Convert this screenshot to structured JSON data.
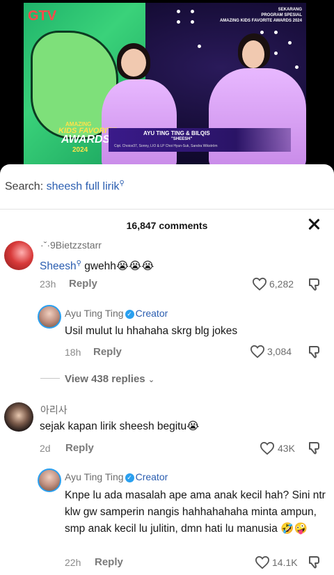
{
  "video": {
    "channel_logo": "GTV",
    "top_right_badge": [
      "SEKARANG",
      "PROGRAM SPESIAL",
      "AMAZING KIDS FAVORITE AWARDS 2024"
    ],
    "award_logo": [
      "AMAZING",
      "KIDS FAVORITE",
      "AWARDS",
      "2024"
    ],
    "lower_third": {
      "performer": "AYU TING TING & BILQIS",
      "song": "\"SHEESH\"",
      "credit": "Cipt. Choice37, Sonny, LIO & LP Choi Hyun-Suk, Sandra Wikström"
    }
  },
  "search": {
    "prefix": "Search: ",
    "query": "sheesh full lirik",
    "icon": "search-icon"
  },
  "comments_header": {
    "count_label": "16,847 comments",
    "close_icon": "close-icon"
  },
  "comments": [
    {
      "username": "·ˇ·9Bietzzstarr",
      "text_link": "Sheesh",
      "text_rest": " gwehh😭😭😭",
      "time": "23h",
      "reply_label": "Reply",
      "likes": "6,282",
      "avatar_color": "#d83a3a"
    },
    {
      "username": "Ayu Ting Ting",
      "creator_label": "Creator",
      "text": "Usil mulut lu hhahaha skrg blg jokes",
      "time": "18h",
      "reply_label": "Reply",
      "likes": "3,084"
    },
    {
      "username": "아리사",
      "text": "sejak kapan lirik sheesh begitu😭",
      "time": "2d",
      "reply_label": "Reply",
      "likes": "43K"
    },
    {
      "username": "Ayu Ting Ting",
      "creator_label": "Creator",
      "text": "Knpe lu ada masalah ape ama anak kecil hah? Sini ntr klw gw samperin nangis hahhahahaha minta ampun, smp anak kecil lu julitin, dmn hati lu manusia 🤣🤪",
      "time": "22h",
      "reply_label": "Reply",
      "likes": "14.1K"
    }
  ],
  "view_replies": "View 438 replies"
}
